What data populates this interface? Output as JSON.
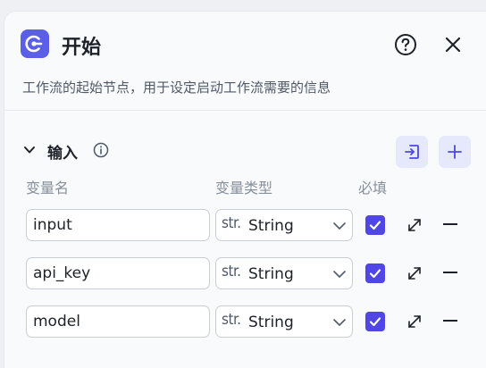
{
  "header": {
    "title": "开始",
    "description": "工作流的起始节点，用于设定启动工作流需要的信息",
    "app_icon": "start-node-icon",
    "help_icon": "help-circle-icon",
    "close_icon": "close-icon"
  },
  "inputs_section": {
    "title": "输入",
    "info_icon": "info-icon",
    "import_icon": "import-icon",
    "add_icon": "plus-icon",
    "columns": {
      "name": "变量名",
      "type": "变量类型",
      "required": "必填"
    },
    "rows": [
      {
        "name": "input",
        "type_prefix": "str.",
        "type": "String",
        "required": true
      },
      {
        "name": "api_key",
        "type_prefix": "str.",
        "type": "String",
        "required": true
      },
      {
        "name": "model",
        "type_prefix": "str.",
        "type": "String",
        "required": true
      }
    ]
  },
  "colors": {
    "accent": "#5b5fe8",
    "checkbox": "#4f46e5",
    "button_bg": "#e6e8fb"
  }
}
